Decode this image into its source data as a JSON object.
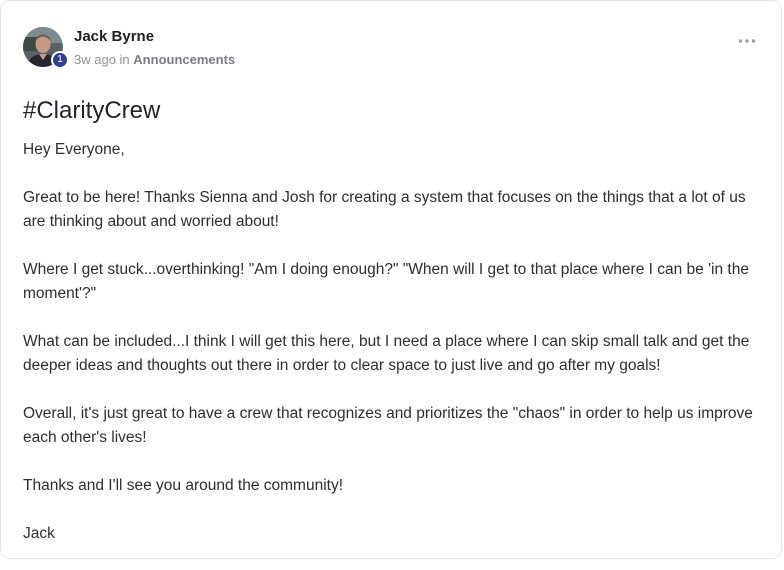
{
  "post": {
    "author_name": "Jack Byrne",
    "author_level": "1",
    "time_ago": "3w ago",
    "in_word": "in",
    "category": "Announcements",
    "title": "#ClarityCrew",
    "paragraphs": [
      "Hey Everyone,",
      "Great to be here! Thanks Sienna and Josh for creating a system that focuses on the things that a lot of us are thinking about and worried about!",
      "Where I get stuck...overthinking! \"Am I doing enough?\" \"When will I get to that place where I can be 'in the moment'?\"",
      "What can be included...I think I will get this here, but I need a place where I can skip small talk and get the deeper ideas and thoughts out there in order to clear space to just live and go after my goals!",
      "Overall, it's just great to have a crew that recognizes and prioritizes the \"chaos\" in order to help us improve each other's lives!",
      "Thanks and I'll see you around the community!",
      "Jack"
    ]
  },
  "icons": {
    "more": "more-horizontal-icon",
    "avatar": "user-avatar"
  },
  "colors": {
    "level_badge": "#2f3e8f",
    "muted_text": "#909399",
    "text": "#2b2f33"
  }
}
